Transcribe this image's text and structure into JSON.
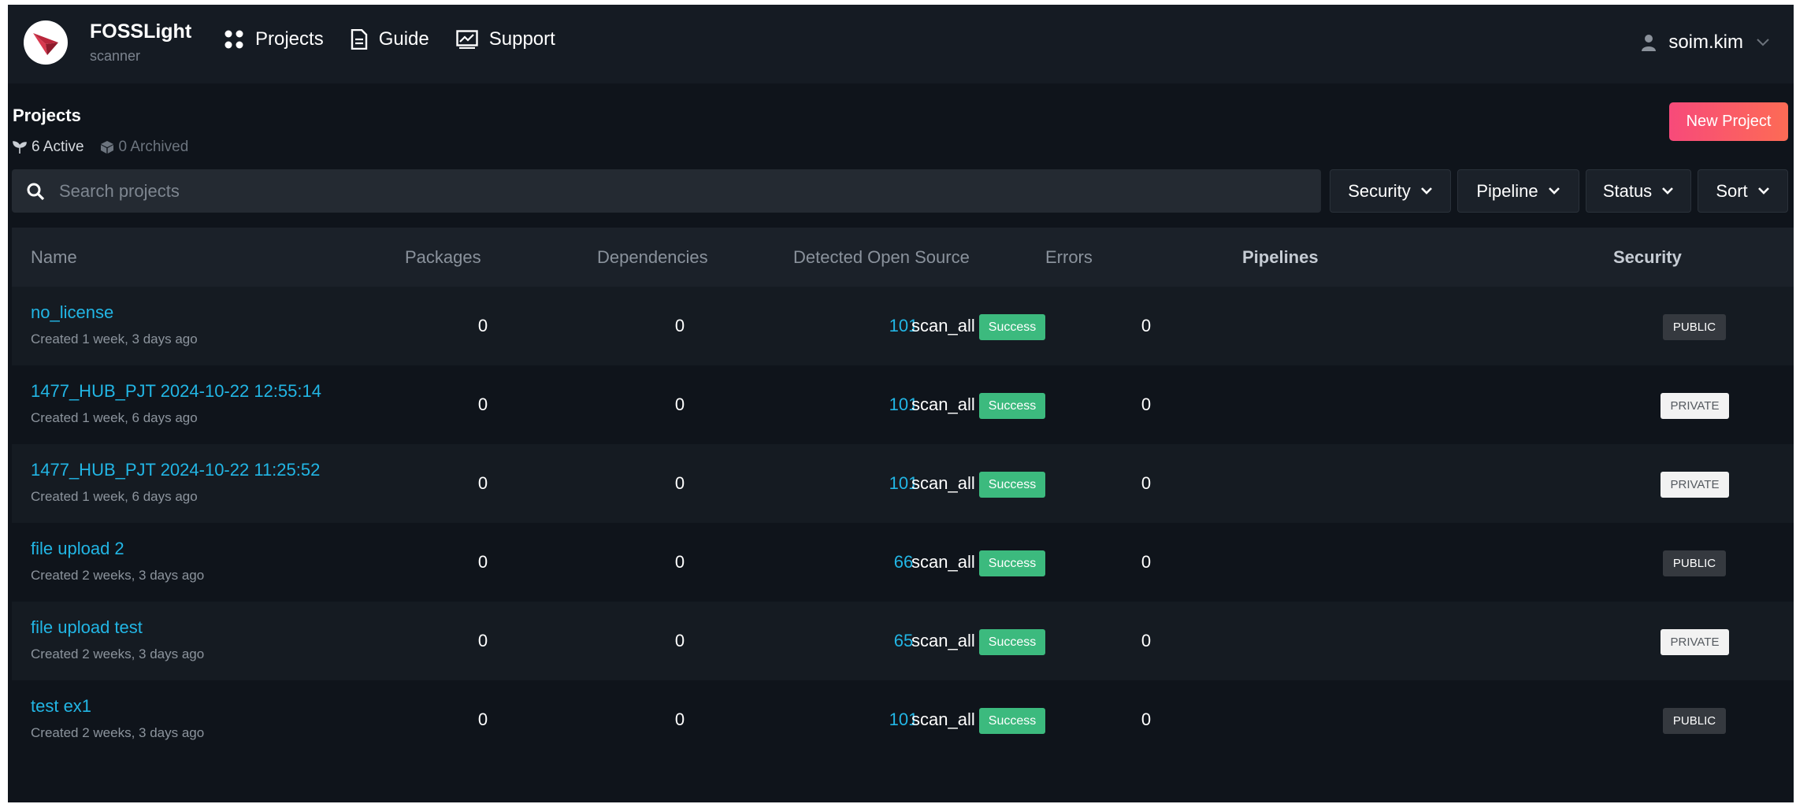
{
  "header": {
    "brand_name": "FOSSLight",
    "brand_sub": "scanner",
    "nav": [
      {
        "label": "Projects",
        "icon": "dots-grid-icon"
      },
      {
        "label": "Guide",
        "icon": "document-icon"
      },
      {
        "label": "Support",
        "icon": "chart-window-icon"
      }
    ],
    "user": {
      "name": "soim.kim",
      "icon": "user-icon"
    }
  },
  "page": {
    "title": "Projects",
    "active_count": "6 Active",
    "archived_count": "0 Archived",
    "new_project_label": "New Project"
  },
  "search": {
    "placeholder": "Search projects",
    "value": ""
  },
  "filters": [
    {
      "label": "Security"
    },
    {
      "label": "Pipeline"
    },
    {
      "label": "Status"
    },
    {
      "label": "Sort"
    }
  ],
  "table": {
    "columns": [
      "Name",
      "Packages",
      "Dependencies",
      "Detected Open Source",
      "Errors",
      "Pipelines",
      "Security"
    ],
    "rows": [
      {
        "name": "no_license",
        "created": "Created 1 week, 3 days ago",
        "packages": "0",
        "dependencies": "0",
        "detected": "101",
        "errors": "0",
        "pipeline": "scan_all",
        "status": "Success",
        "security": "PUBLIC"
      },
      {
        "name": "1477_HUB_PJT 2024-10-22 12:55:14",
        "created": "Created 1 week, 6 days ago",
        "packages": "0",
        "dependencies": "0",
        "detected": "101",
        "errors": "0",
        "pipeline": "scan_all",
        "status": "Success",
        "security": "PRIVATE"
      },
      {
        "name": "1477_HUB_PJT 2024-10-22 11:25:52",
        "created": "Created 1 week, 6 days ago",
        "packages": "0",
        "dependencies": "0",
        "detected": "101",
        "errors": "0",
        "pipeline": "scan_all",
        "status": "Success",
        "security": "PRIVATE"
      },
      {
        "name": "file upload 2",
        "created": "Created 2 weeks, 3 days ago",
        "packages": "0",
        "dependencies": "0",
        "detected": "66",
        "errors": "0",
        "pipeline": "scan_all",
        "status": "Success",
        "security": "PUBLIC"
      },
      {
        "name": "file upload test",
        "created": "Created 2 weeks, 3 days ago",
        "packages": "0",
        "dependencies": "0",
        "detected": "65",
        "errors": "0",
        "pipeline": "scan_all",
        "status": "Success",
        "security": "PRIVATE"
      },
      {
        "name": "test ex1",
        "created": "Created 2 weeks, 3 days ago",
        "packages": "0",
        "dependencies": "0",
        "detected": "101",
        "errors": "0",
        "pipeline": "scan_all",
        "status": "Success",
        "security": "PUBLIC"
      }
    ]
  },
  "colors": {
    "background": "#0f141b",
    "header": "#151b23",
    "link": "#22b6e5",
    "success": "#3cba7e",
    "accent_start": "#f74a7a",
    "accent_end": "#fd6b55"
  }
}
